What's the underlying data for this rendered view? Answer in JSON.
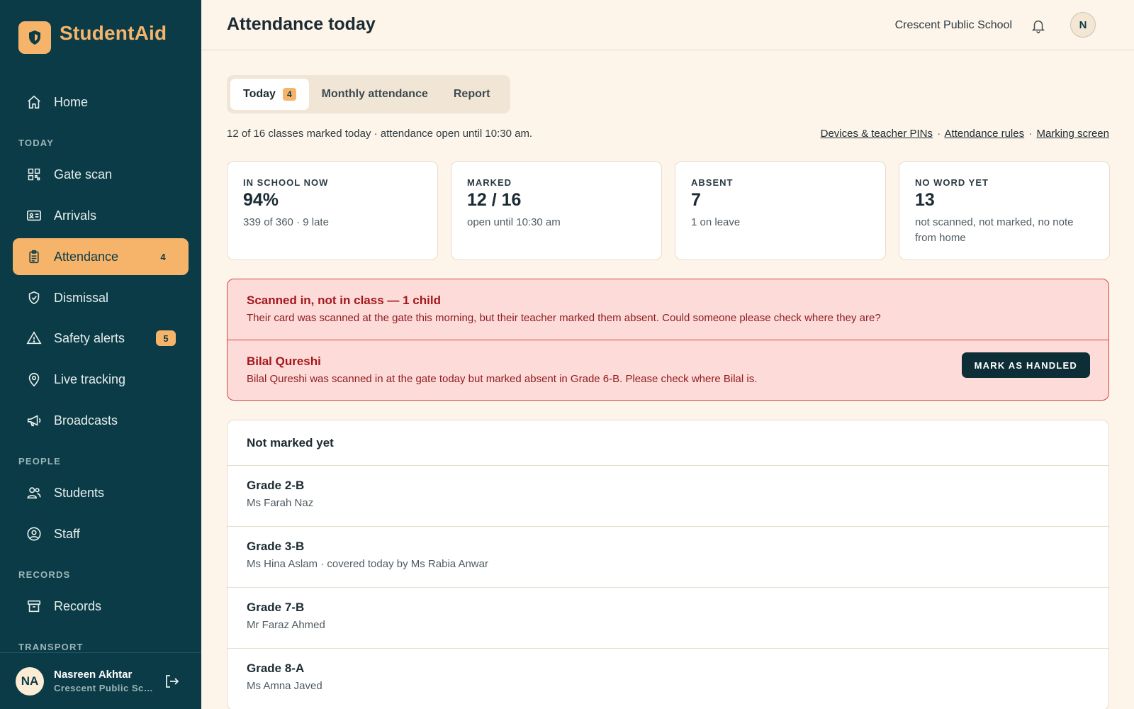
{
  "brand": {
    "name": "StudentAid"
  },
  "sidebar": {
    "home": "Home",
    "sections": {
      "today": "TODAY",
      "people": "PEOPLE",
      "records": "RECORDS",
      "transport": "TRANSPORT"
    },
    "items": {
      "gate_scan": "Gate scan",
      "arrivals": "Arrivals",
      "attendance": {
        "label": "Attendance",
        "badge": "4"
      },
      "dismissal": "Dismissal",
      "safety_alerts": {
        "label": "Safety alerts",
        "badge": "5"
      },
      "live_tracking": "Live tracking",
      "broadcasts": "Broadcasts",
      "students": "Students",
      "staff": "Staff",
      "records": "Records"
    },
    "user": {
      "initials": "NA",
      "name": "Nasreen Akhtar",
      "school": "Crescent Public School"
    }
  },
  "header": {
    "title": "Attendance today",
    "school": "Crescent Public School",
    "avatar_initial": "N"
  },
  "tabs": [
    {
      "label": "Today",
      "count": "4"
    },
    {
      "label": "Monthly attendance"
    },
    {
      "label": "Report"
    }
  ],
  "summary_line": "12 of 16 classes marked today · attendance open until 10:30 am.",
  "links": {
    "devices": "Devices & teacher PINs",
    "rules": "Attendance rules",
    "marking": "Marking screen",
    "separator": "·"
  },
  "stats": [
    {
      "label": "IN SCHOOL NOW",
      "value": "94%",
      "sub": "339 of 360 · 9 late"
    },
    {
      "label": "MARKED",
      "value": "12 / 16",
      "sub": "open until 10:30 am"
    },
    {
      "label": "ABSENT",
      "value": "7",
      "sub": "1 on leave"
    },
    {
      "label": "NO WORD YET",
      "value": "13",
      "sub": "not scanned, not marked, no note from home"
    }
  ],
  "alert": {
    "title": "Scanned in, not in class — 1 child",
    "text": "Their card was scanned at the gate this morning, but their teacher marked them absent. Could someone please check where they are?",
    "student": {
      "name": "Bilal Qureshi",
      "text": "Bilal Qureshi was scanned in at the gate today but marked absent in Grade 6-B. Please check where Bilal is."
    },
    "button": "MARK AS HANDLED"
  },
  "not_marked": {
    "title": "Not marked yet",
    "rows": [
      {
        "grade": "Grade 2-B",
        "teacher": "Ms Farah Naz"
      },
      {
        "grade": "Grade 3-B",
        "teacher": "Ms Hina Aslam · covered today by Ms Rabia Anwar"
      },
      {
        "grade": "Grade 7-B",
        "teacher": "Mr Faraz Ahmed"
      },
      {
        "grade": "Grade 8-A",
        "teacher": "Ms Amna Javed"
      }
    ]
  },
  "colors": {
    "sidebar": "#0b3b47",
    "accent": "#f6b46a",
    "alert_bg": "#fddbd8",
    "alert_border": "#d9444a",
    "page_bg": "#fdf5ea"
  }
}
